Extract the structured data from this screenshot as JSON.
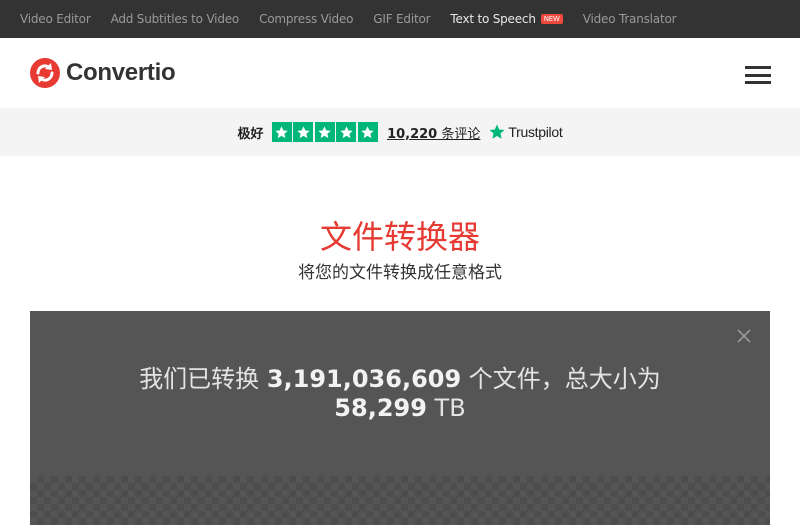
{
  "topnav": {
    "items": [
      {
        "label": "Video Editor"
      },
      {
        "label": "Add Subtitles to Video"
      },
      {
        "label": "Compress Video"
      },
      {
        "label": "GIF Editor"
      },
      {
        "label": "Text to Speech",
        "badge": "NEW"
      },
      {
        "label": "Video Translator"
      }
    ]
  },
  "header": {
    "logo_text": "Convertio",
    "menu_icon": "hamburger-menu-icon"
  },
  "trust": {
    "rating_label": "极好",
    "stars": 5,
    "review_count": "10,220",
    "review_suffix": " 条评论",
    "brand": "Trustpilot"
  },
  "hero": {
    "title": "文件转换器",
    "subtitle": "将您的文件转换成任意格式"
  },
  "stats": {
    "prefix": "我们已转换 ",
    "files_count": "3,191,036,609",
    "middle": " 个文件，总大小为",
    "size_value": "58,299",
    "size_unit": " TB"
  },
  "colors": {
    "brand_red": "#e63a32",
    "trustpilot_green": "#00b67a",
    "topbar_bg": "#333333",
    "panel_bg": "#555555"
  }
}
